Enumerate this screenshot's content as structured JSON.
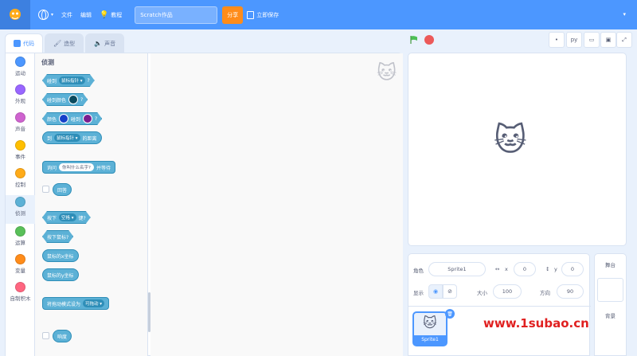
{
  "menubar": {
    "language_icon": "globe-icon",
    "file": "文件",
    "edit": "编辑",
    "tutorial": "教程",
    "project_title": "Scratch作品",
    "share": "分享",
    "save_now": "立即保存"
  },
  "tabs": [
    {
      "label": "代码",
      "icon": "code-icon"
    },
    {
      "label": "造型",
      "icon": "brush-icon"
    },
    {
      "label": "声音",
      "icon": "speaker-icon"
    }
  ],
  "categories": [
    {
      "label": "运动",
      "color": "#4c97ff"
    },
    {
      "label": "外观",
      "color": "#9966ff"
    },
    {
      "label": "声音",
      "color": "#cf63cf"
    },
    {
      "label": "事件",
      "color": "#ffbf00"
    },
    {
      "label": "控制",
      "color": "#ffab19"
    },
    {
      "label": "侦测",
      "color": "#5cb1d6"
    },
    {
      "label": "运算",
      "color": "#59c059"
    },
    {
      "label": "变量",
      "color": "#ff8c1a"
    },
    {
      "label": "自制积木",
      "color": "#ff6680"
    }
  ],
  "palette": {
    "heading": "侦测",
    "touching": "碰到",
    "mouse_pointer": "鼠标指针",
    "question": "?",
    "touching_color": "碰到颜色",
    "color": "颜色",
    "touches": "碰到",
    "distance_to": "到",
    "distance_suffix": "的距离",
    "ask": "询问",
    "ask_default": "你叫什么名字?",
    "and_wait": "并等待",
    "answer": "回答",
    "key_pressed_a": "按下",
    "key_space": "空格",
    "key_pressed_b": "键?",
    "mouse_down": "按下鼠标?",
    "mouse_x": "鼠标的x坐标",
    "mouse_y": "鼠标的y坐标",
    "set_drag": "将拖动模式设为",
    "draggable": "可拖动",
    "loudness": "响度",
    "swatch_1": "#0b4a5e",
    "swatch_2": "#1540c9",
    "swatch_3": "#7a1e8f"
  },
  "stage_controls": {
    "flag_icon": "green-flag-icon",
    "stop_icon": "stop-icon",
    "py_label": "py"
  },
  "sprite_info": {
    "sprite_label": "角色",
    "sprite_name": "Sprite1",
    "x_label": "x",
    "x_value": "0",
    "y_label": "y",
    "y_value": "0",
    "show_label": "显示",
    "size_label": "大小",
    "size_value": "100",
    "direction_label": "方向",
    "direction_value": "90"
  },
  "sprite_list": [
    {
      "name": "Sprite1"
    }
  ],
  "stage_pane": {
    "title": "舞台",
    "backdrops": "背景"
  },
  "watermark": "www.1subao.cn"
}
